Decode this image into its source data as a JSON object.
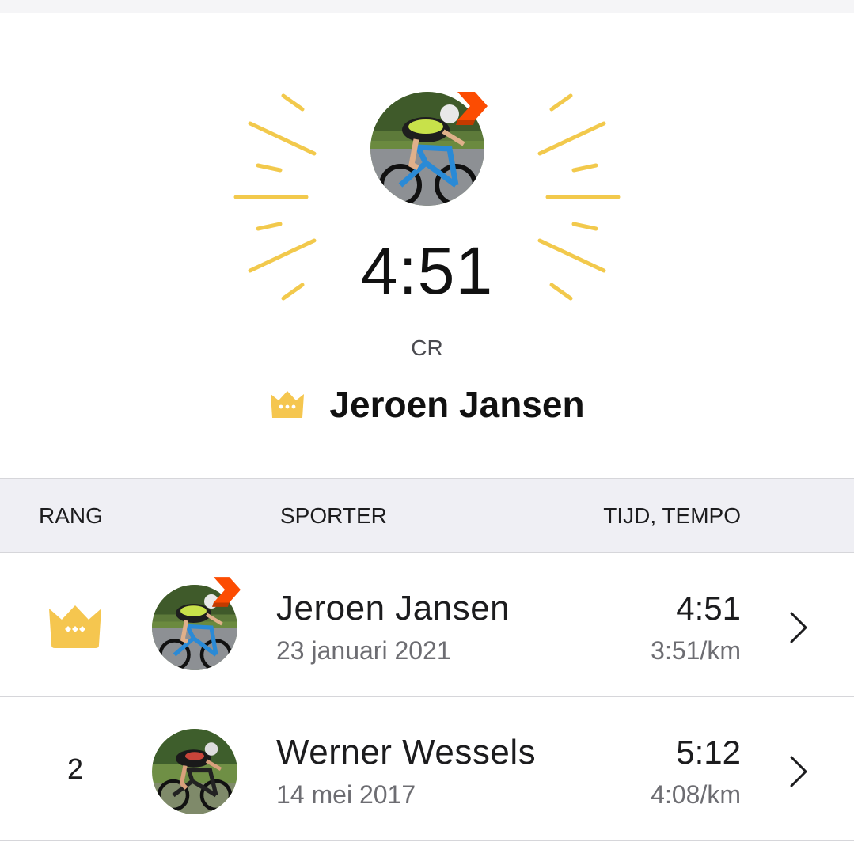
{
  "hero": {
    "time": "4:51",
    "label": "CR",
    "holder_name": "Jeroen Jansen",
    "crown_icon": "crown-icon",
    "ray_color": "#f2c94c"
  },
  "table": {
    "headers": {
      "rank": "RANG",
      "athlete": "SPORTER",
      "time_pace": "TIJD, TEMPO"
    },
    "rows": [
      {
        "rank": "",
        "rank_icon": "crown-icon",
        "name": "Jeroen Jansen",
        "date": "23 januari 2021",
        "time": "4:51",
        "pace": "3:51/km",
        "subscriber_badge": true
      },
      {
        "rank": "2",
        "name": "Werner Wessels",
        "date": "14 mei 2017",
        "time": "5:12",
        "pace": "4:08/km",
        "subscriber_badge": false
      }
    ]
  },
  "colors": {
    "crown": "#f5c64f",
    "strava_orange": "#fc4c02",
    "header_bg": "#efeff4"
  }
}
